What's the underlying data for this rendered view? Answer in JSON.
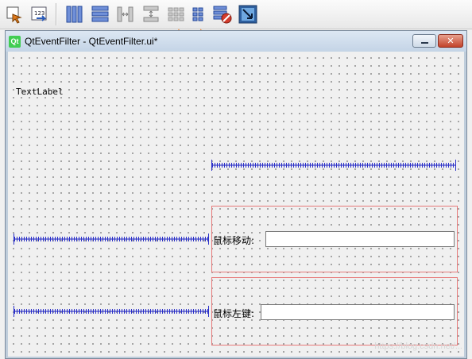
{
  "toolbar": {
    "icons": [
      "edit-widgets-icon",
      "edit-tab-order-icon",
      "layout-horizontal-icon",
      "layout-vertical-icon",
      "layout-horizontal-splitter-icon",
      "layout-vertical-splitter-icon",
      "layout-grid-icon",
      "layout-form-icon",
      "break-layout-icon",
      "adjust-size-icon"
    ]
  },
  "window": {
    "logo": "Qt",
    "title": "QtEventFilter - QtEventFilter.ui*",
    "close_glyph": "✕"
  },
  "form": {
    "text_label": "TextLabel",
    "mouse_move_label": "鼠标移动:",
    "left_button_label": "鼠标左键:"
  },
  "watermark": "https://blog.csdn.net/..."
}
